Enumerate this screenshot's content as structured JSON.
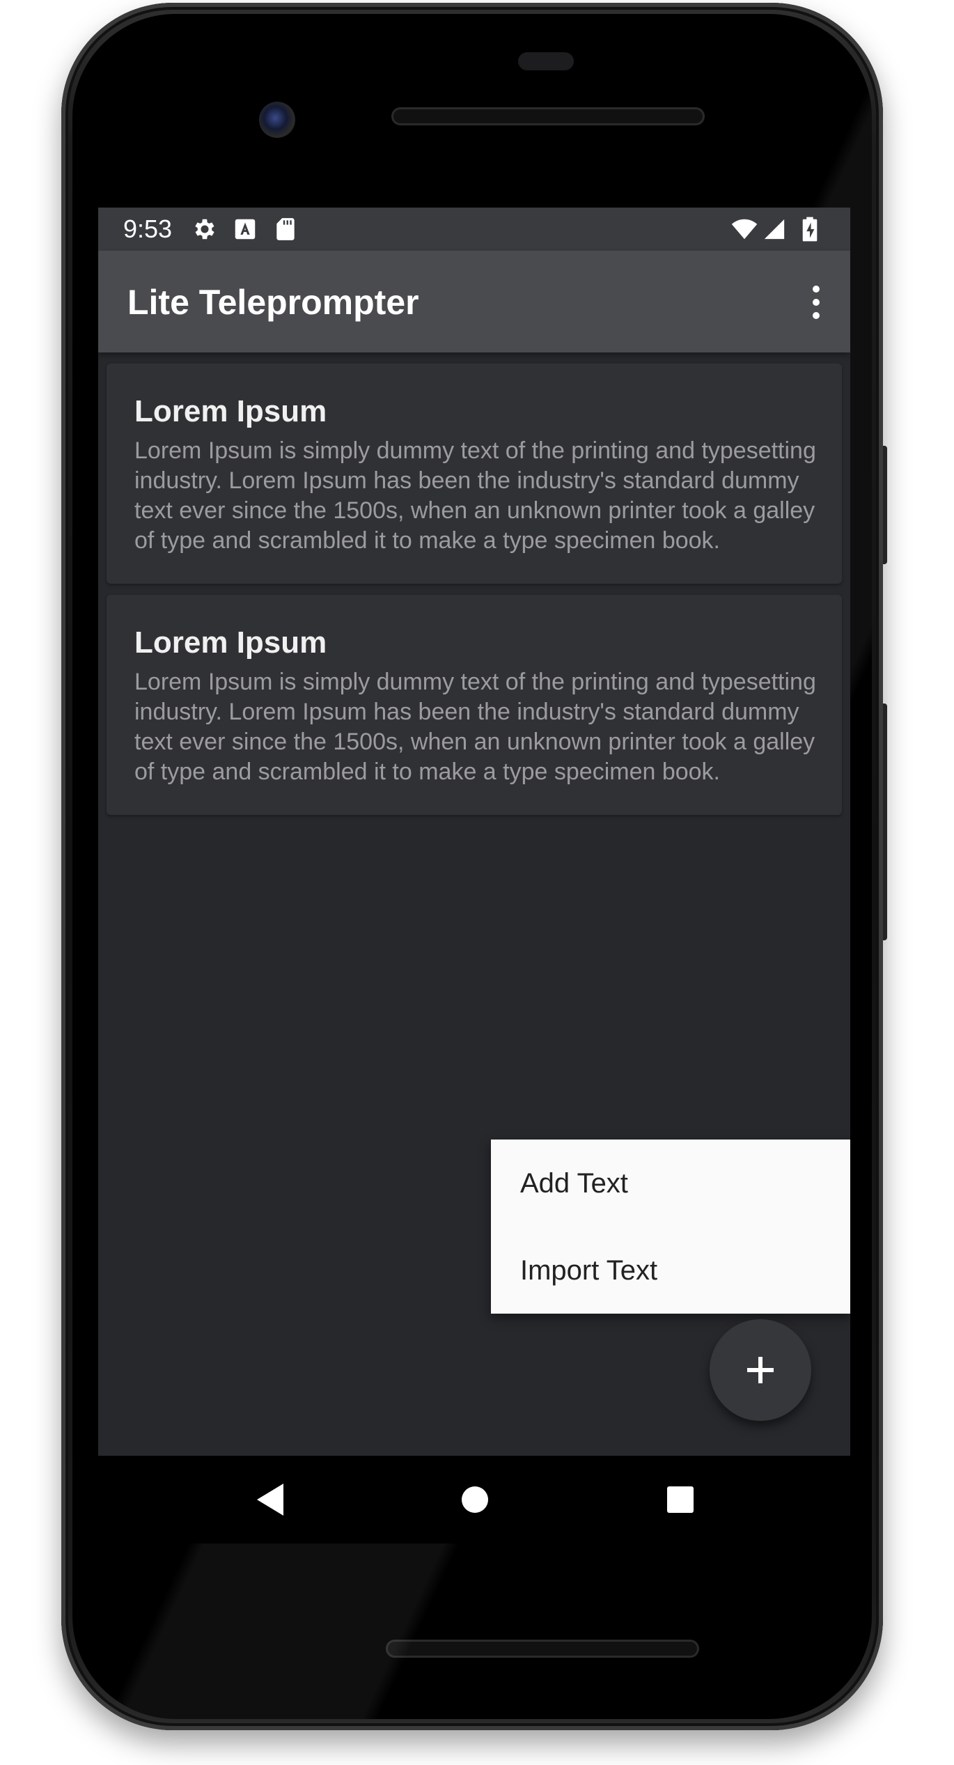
{
  "status_bar": {
    "time": "9:53",
    "icons": [
      "gear-icon",
      "font-a-icon",
      "sd-card-icon",
      "wifi-icon",
      "cell-signal-icon",
      "battery-charging-icon"
    ]
  },
  "app_bar": {
    "title": "Lite Teleprompter",
    "overflow_icon": "more-vert-icon"
  },
  "cards": [
    {
      "title": "Lorem Ipsum",
      "body": "Lorem Ipsum is simply dummy text of the printing and typesetting industry. Lorem Ipsum has been the industry's standard dummy text ever since the 1500s, when an unknown printer took a galley of type and scrambled it to make a type specimen book."
    },
    {
      "title": "Lorem Ipsum",
      "body": "Lorem Ipsum is simply dummy text of the printing and typesetting industry. Lorem Ipsum has been the industry's standard dummy text ever since the 1500s, when an unknown printer took a galley of type and scrambled it to make a type specimen book."
    }
  ],
  "popup_menu": {
    "items": [
      {
        "label": "Add Text"
      },
      {
        "label": "Import Text"
      }
    ]
  },
  "fab": {
    "icon": "plus-icon"
  },
  "nav_bar": {
    "icons": [
      "back-triangle-icon",
      "home-circle-icon",
      "recents-square-icon"
    ]
  },
  "colors": {
    "screen_bg": "#27282c",
    "app_bar": "#4a4b4f",
    "status_bar": "#3a3b3f",
    "card_bg": "#303135",
    "menu_bg": "#fafafa",
    "fab_bg": "#36373b"
  }
}
